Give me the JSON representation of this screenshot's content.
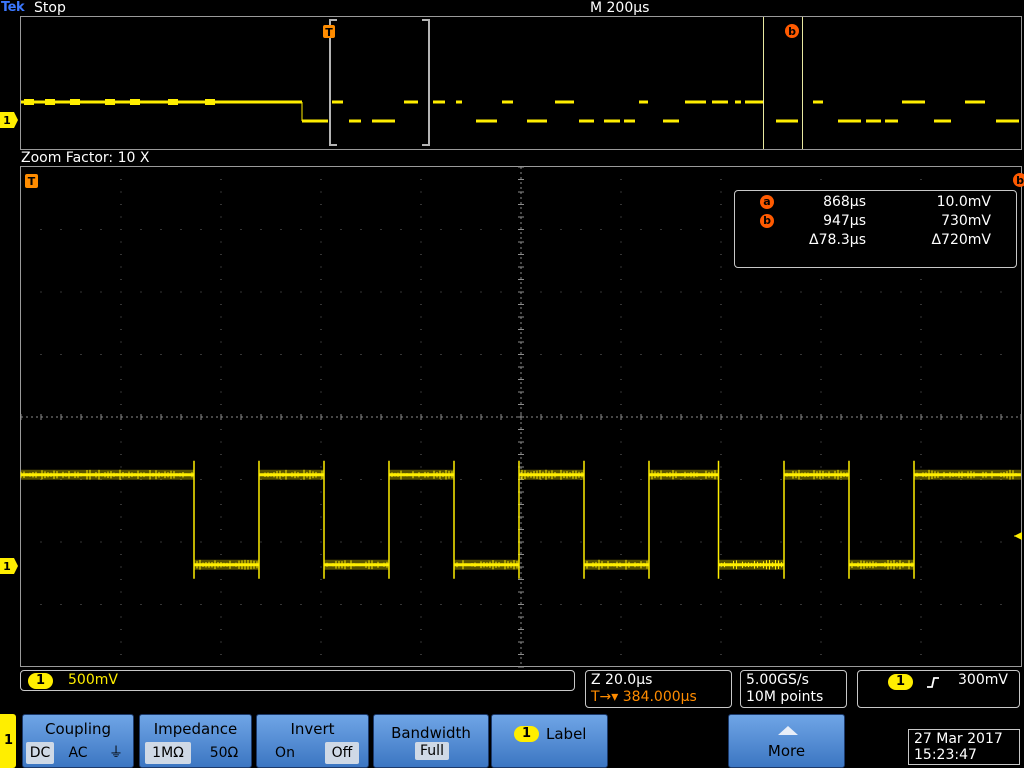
{
  "header": {
    "brand": "Tek",
    "acquisition_status": "Stop",
    "timebase": "M 200µs"
  },
  "overview": {
    "trigger_marker": "T",
    "cursor_b_marker": "b",
    "channel_marker": "1"
  },
  "zoom": {
    "label": "Zoom Factor: 10 X",
    "trigger_marker": "T",
    "channel_marker": "1",
    "cursor_b_edge_marker": "b",
    "waveform_levels_volts": {
      "high": 0.73,
      "low": 0.01
    },
    "transitions_us": [
      888.6,
      901.6,
      914.6,
      927.6,
      940.6,
      953.6,
      966.6,
      979.6,
      993.5,
      1006.6,
      1019.6,
      1032.6
    ]
  },
  "cursor_readout": {
    "a": {
      "badge": "a",
      "time": "868µs",
      "volt": "10.0mV"
    },
    "b": {
      "badge": "b",
      "time": "947µs",
      "volt": "730mV"
    },
    "delta": {
      "time": "Δ78.3µs",
      "volt": "Δ720mV"
    }
  },
  "channel_info": {
    "channel": "1",
    "scale": "500mV"
  },
  "zoom_info": {
    "scale": "Z 20.0µs",
    "trigger_position": "T→▾ 384.000µs"
  },
  "acquisition": {
    "sample_rate": "5.00GS/s",
    "record_length": "10M points"
  },
  "trigger_info": {
    "channel": "1",
    "slope_icon": "rising-edge",
    "level": "300mV"
  },
  "menu": {
    "side_channel": "1",
    "coupling": {
      "title": "Coupling",
      "options": [
        "DC",
        "AC",
        "⏚"
      ],
      "selected": "DC"
    },
    "impedance": {
      "title": "Impedance",
      "options": [
        "1MΩ",
        "50Ω"
      ],
      "selected": "1MΩ"
    },
    "invert": {
      "title": "Invert",
      "options": [
        "On",
        "Off"
      ],
      "selected": "Off"
    },
    "bandwidth": {
      "title": "Bandwidth",
      "value": "Full"
    },
    "label": {
      "channel": "1",
      "title": "Label"
    },
    "more": {
      "title": "More"
    }
  },
  "datetime": {
    "date": "27 Mar 2017",
    "time": "15:23:47"
  },
  "colors": {
    "trace": "#ffee00",
    "cursor_badge": "#ff5a00",
    "menu_blue": "#4a86d0",
    "grid": "#8c8c8c"
  }
}
